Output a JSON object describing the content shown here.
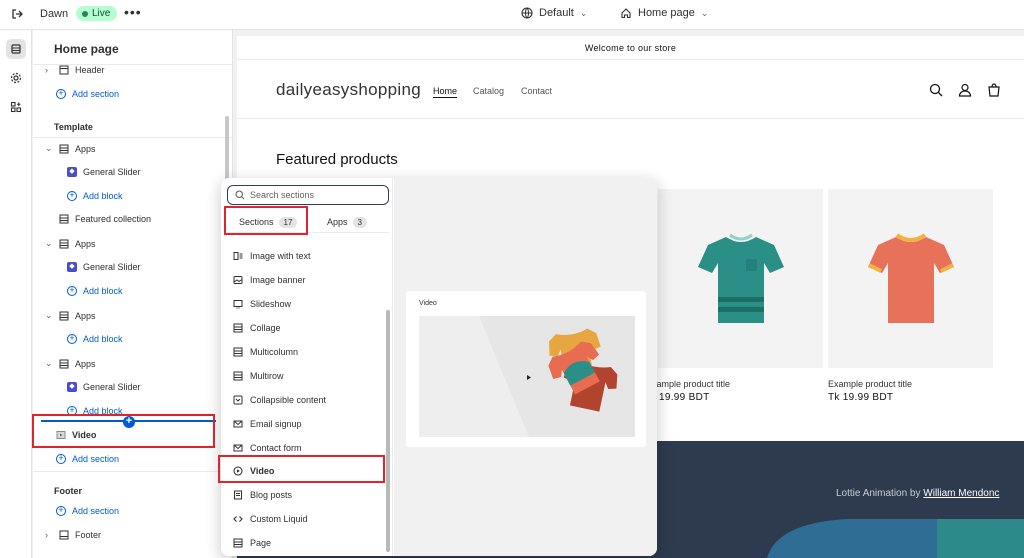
{
  "topbar": {
    "theme_name": "Dawn",
    "status": "Live",
    "more_label": "•••",
    "theme_selector": "Default",
    "page_selector": "Home page"
  },
  "sidebar": {
    "title": "Home page",
    "header_item": "Header",
    "add_section": "Add section",
    "template_label": "Template",
    "apps": "Apps",
    "general_slider": "General Slider",
    "add_block": "Add block",
    "featured_collection": "Featured collection",
    "video_item": "Video",
    "footer_label": "Footer",
    "footer_item": "Footer"
  },
  "preview": {
    "announcement": "Welcome to our store",
    "store_name": "dailyeasyshopping",
    "nav": [
      "Home",
      "Catalog",
      "Contact"
    ],
    "featured_title": "Featured products",
    "product_titles": [
      "xample product title",
      "Example product title"
    ],
    "product_prices": [
      "19.99 BDT",
      "Tk 19.99 BDT"
    ],
    "lottie_prefix": "Lottie Animation by ",
    "lottie_author": "William Mendonc"
  },
  "popover": {
    "search_placeholder": "Search sections",
    "tab_sections": "Sections",
    "tab_sections_count": "17",
    "tab_apps": "Apps",
    "tab_apps_count": "3",
    "items": [
      {
        "label": "Image with text",
        "icon": "image-text-icon"
      },
      {
        "label": "Image banner",
        "icon": "image-banner-icon"
      },
      {
        "label": "Slideshow",
        "icon": "slideshow-icon"
      },
      {
        "label": "Collage",
        "icon": "collage-icon"
      },
      {
        "label": "Multicolumn",
        "icon": "multicolumn-icon"
      },
      {
        "label": "Multirow",
        "icon": "multirow-icon"
      },
      {
        "label": "Collapsible content",
        "icon": "collapsible-icon"
      },
      {
        "label": "Email signup",
        "icon": "email-icon"
      },
      {
        "label": "Contact form",
        "icon": "contact-form-icon"
      },
      {
        "label": "Video",
        "icon": "play-icon"
      },
      {
        "label": "Blog posts",
        "icon": "blog-icon"
      },
      {
        "label": "Custom Liquid",
        "icon": "code-icon"
      },
      {
        "label": "Page",
        "icon": "page-icon"
      }
    ],
    "preview_label": "Video"
  },
  "colors": {
    "accent": "#005bd3",
    "highlight": "#e0242e",
    "live_badge": "#b4fed2",
    "teal_shirt": "#2a8f87",
    "red_shirt": "#e8715a"
  }
}
